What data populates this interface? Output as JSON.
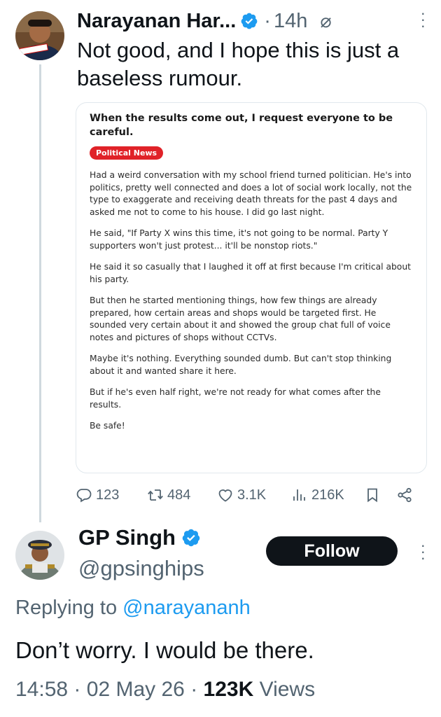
{
  "tweet1": {
    "name": "Narayanan Har...",
    "time": "14h",
    "text": "Not good, and I hope this is just a baseless rumour.",
    "card": {
      "title": "When the results come out, I request everyone to be careful.",
      "badge": "Political News",
      "paragraphs": [
        "Had a weird conversation with my school friend turned politician. He's into politics, pretty well connected and does a lot of social work locally, not the type to exaggerate and receiving death threats for the past 4 days and asked me not to come to his house. I did go last night.",
        "He said, \"If Party X wins this time, it's not going to be normal. Party Y supporters won't just protest... it'll be nonstop riots.\"",
        "He said it so casually that I laughed it off at first because I'm critical about his party.",
        "But then he started mentioning things, how few things are already prepared, how certain areas and shops would be targeted first. He sounded very certain about it and showed the group chat full of voice notes and pictures of shops without CCTVs.",
        "Maybe it's nothing. Everything sounded dumb. But can't stop thinking about it and wanted share it here.",
        "But if he's even half right, we're not ready for what comes after the results.",
        "Be safe!"
      ]
    },
    "stats": {
      "replies": "123",
      "retweets": "484",
      "likes": "3.1K",
      "views": "216K"
    }
  },
  "tweet2": {
    "name": "GP Singh",
    "handle": "@gpsinghips",
    "follow_label": "Follow",
    "replying_prefix": "Replying to",
    "replying_to": "@narayananh",
    "text": "Don’t worry. I would be there.",
    "time": "14:58",
    "date": "02 May 26",
    "views_count": "123K",
    "views_label": "Views"
  },
  "colors": {
    "verified": "#1d9bf0",
    "muted": "#536471",
    "badge": "#e02228",
    "follow_bg": "#0f1419"
  }
}
